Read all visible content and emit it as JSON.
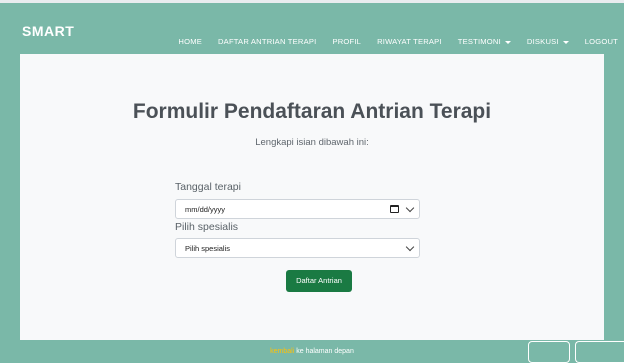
{
  "brand": "SMART",
  "nav": {
    "items": [
      "HOME",
      "DAFTAR ANTRIAN TERAPI",
      "PROFIL",
      "RIWAYAT TERAPI"
    ],
    "dropdowns": [
      "TESTIMONI",
      "DISKUSI"
    ],
    "logout": "LOGOUT"
  },
  "form": {
    "title": "Formulir Pendaftaran Antrian Terapi",
    "subtitle": "Lengkapi isian dibawah ini:",
    "date_label": "Tanggal terapi",
    "date_placeholder": "mm/dd/yyyy",
    "specialist_label": "Pilih spesialis",
    "specialist_selected": "Pilih spesialis",
    "submit_label": "Daftar Antrian"
  },
  "footer": {
    "link_text": "kembali",
    "text": "ke halaman depan"
  },
  "icons": {
    "calendar": "calendar-icon",
    "chevron": "chevron-down-icon",
    "caret": "caret-down-icon"
  },
  "colors": {
    "background": "#7ab8a8",
    "card": "#f8f9fa",
    "button": "#1a7a43",
    "link": "#ffc107"
  }
}
